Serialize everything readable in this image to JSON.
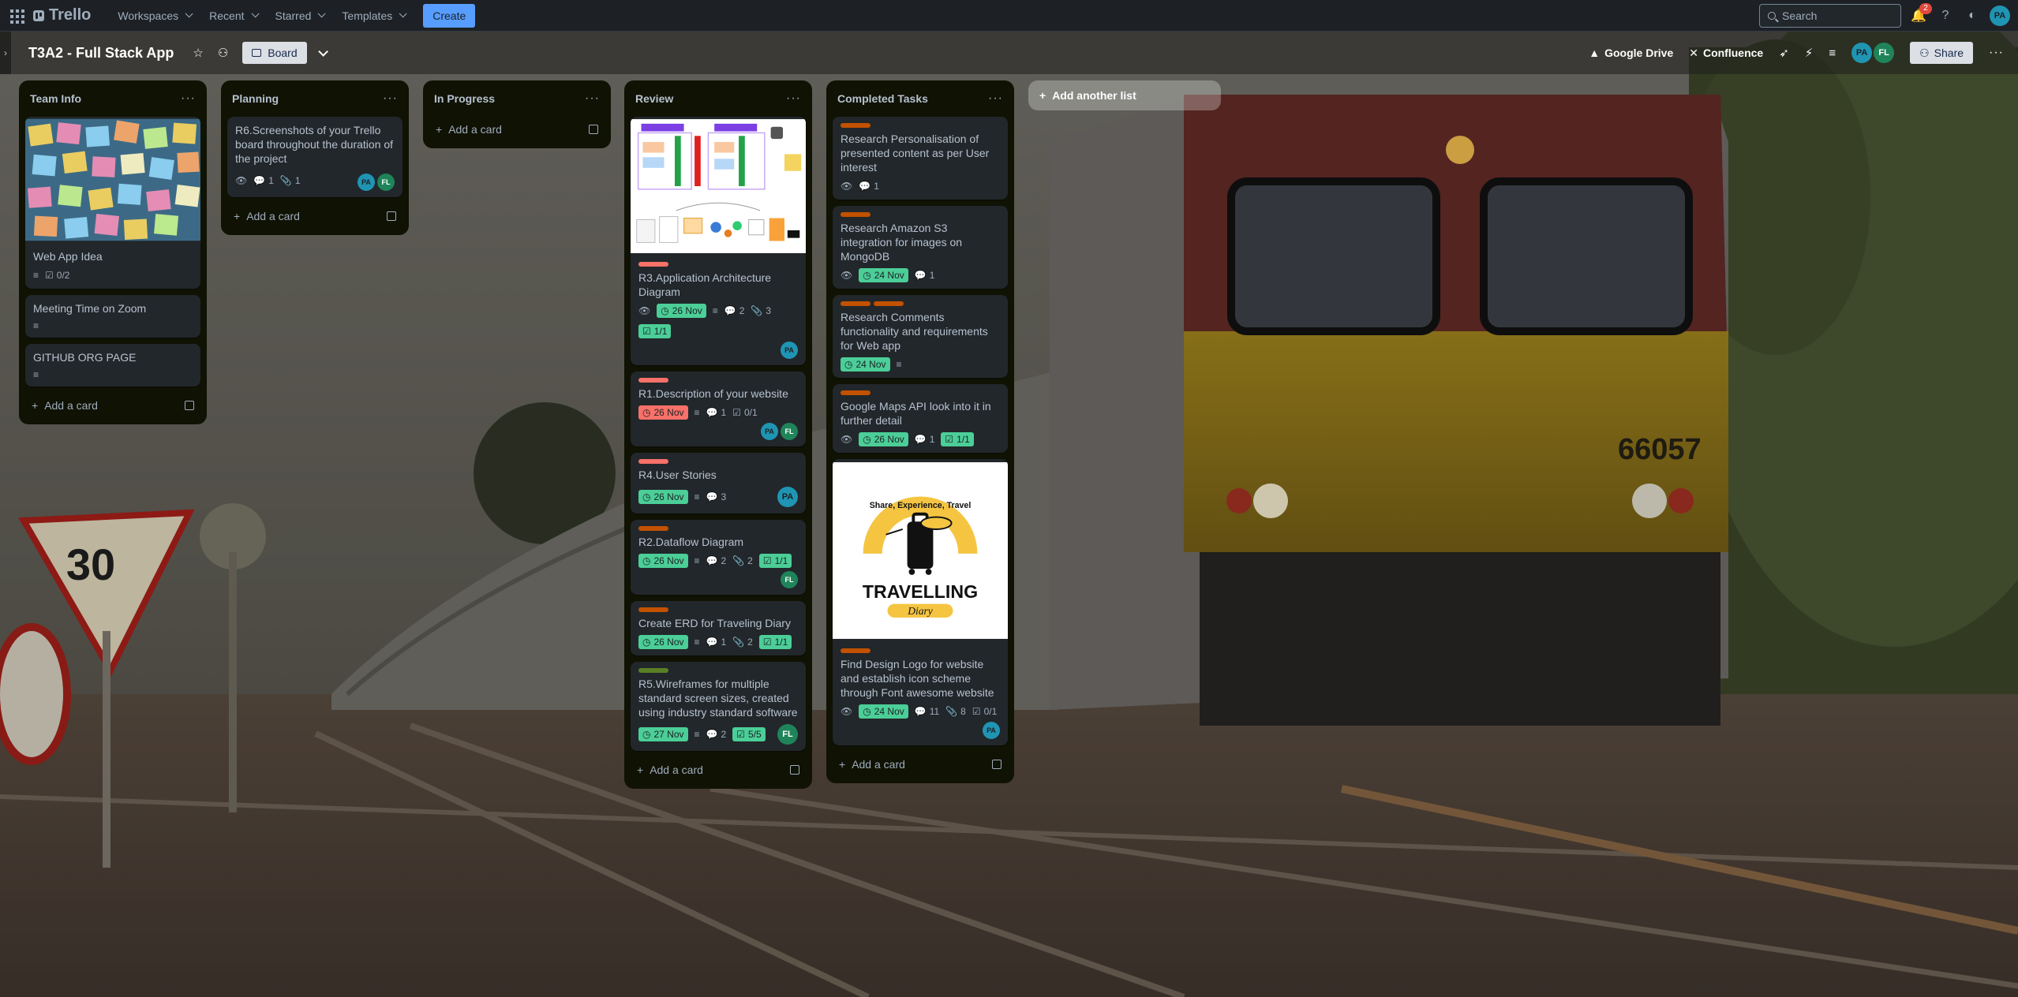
{
  "topnav": {
    "logo": "Trello",
    "items": [
      "Workspaces",
      "Recent",
      "Starred",
      "Templates"
    ],
    "create_label": "Create",
    "search_placeholder": "Search",
    "notification_count": "2",
    "user_initials": "PA"
  },
  "board": {
    "title": "T3A2 - Full Stack App",
    "view_label": "Board",
    "powerups": [
      "Google Drive",
      "Confluence"
    ],
    "share_label": "Share",
    "members": [
      "PA",
      "FL"
    ]
  },
  "lists": [
    {
      "title": "Team Info",
      "add_card": "Add a card",
      "cards": [
        {
          "title": "Web App Idea",
          "checklist": "0/2"
        },
        {
          "title": "Meeting Time on Zoom"
        },
        {
          "title": "GITHUB ORG PAGE"
        }
      ]
    },
    {
      "title": "Planning",
      "add_card": "Add a card",
      "cards": [
        {
          "title": "R6.Screenshots of your Trello board throughout the duration of the project",
          "comments": "1",
          "attachments": "1",
          "members": [
            "PA",
            "FL"
          ]
        }
      ]
    },
    {
      "title": "In Progress",
      "add_card": "Add a card",
      "cards": []
    },
    {
      "title": "Review",
      "add_card": "Add a card",
      "cards": [
        {
          "title": "R3.Application Architecture Diagram",
          "due": "26 Nov",
          "comments": "2",
          "attachments": "3",
          "checklist": "1/1",
          "members": [
            "PA"
          ]
        },
        {
          "title": "R1.Description of your website",
          "due": "26 Nov",
          "comments": "1",
          "checklist": "0/1",
          "members": [
            "PA",
            "FL"
          ]
        },
        {
          "title": "R4.User Stories",
          "due": "26 Nov",
          "comments": "3",
          "members": [
            "PA"
          ]
        },
        {
          "title": "R2.Dataflow Diagram",
          "due": "26 Nov",
          "comments": "2",
          "attachments": "2",
          "checklist": "1/1",
          "members": [
            "FL"
          ]
        },
        {
          "title": "Create ERD for Traveling Diary",
          "due": "26 Nov",
          "comments": "1",
          "attachments": "2",
          "checklist": "1/1"
        },
        {
          "title": "R5.Wireframes for multiple standard screen sizes, created using industry standard software",
          "due": "27 Nov",
          "comments": "2",
          "checklist": "5/5",
          "members": [
            "FL"
          ]
        }
      ]
    },
    {
      "title": "Completed Tasks",
      "add_card": "Add a card",
      "cards": [
        {
          "title": "Research Personalisation of presented content as per User interest",
          "comments": "1"
        },
        {
          "title": "Research Amazon S3 integration for images on MongoDB",
          "due": "24 Nov",
          "comments": "1"
        },
        {
          "title": "Research Comments functionality and requirements for Web app",
          "due": "24 Nov"
        },
        {
          "title": "Google Maps API look into it in further detail",
          "due": "26 Nov",
          "comments": "1",
          "checklist": "1/1"
        },
        {
          "title": "Find Design Logo for website and establish icon scheme through Font awesome website",
          "due": "24 Nov",
          "comments": "11",
          "attachments": "8",
          "checklist": "0/1",
          "members": [
            "PA"
          ]
        }
      ]
    }
  ],
  "add_list_label": "Add another list",
  "logo_image": {
    "top_text": "Share, Experience, Travel",
    "brand": "TRAVELLING",
    "sub": "Diary"
  },
  "train_number": "66057",
  "sign_number": "30",
  "colors": {
    "label_red": "#f87168",
    "label_orange": "#c25100",
    "label_green": "#4bce97",
    "label_lime": "#5b7f24",
    "accent": "#579dff"
  }
}
